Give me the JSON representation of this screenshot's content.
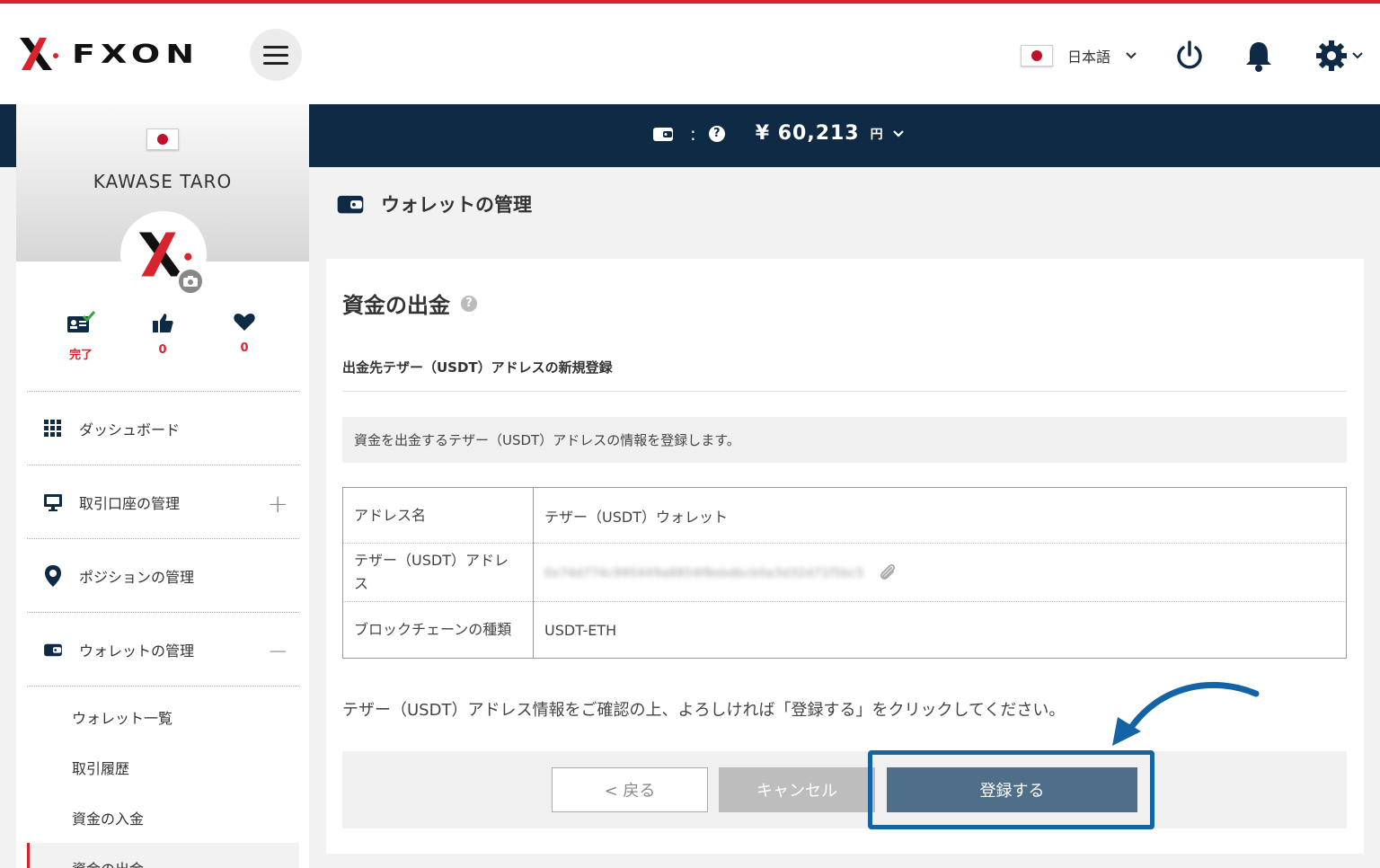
{
  "header": {
    "logo_text": "FXON",
    "language": "日本語"
  },
  "balance": {
    "separator": ":",
    "amount": "¥ 60,213",
    "unit": "円"
  },
  "sidebar": {
    "user_name": "KAWASE TARO",
    "stats": [
      {
        "value": "完了"
      },
      {
        "value": "0"
      },
      {
        "value": "0"
      }
    ],
    "menu": [
      {
        "label": "ダッシュボード"
      },
      {
        "label": "取引口座の管理",
        "toggle": "+"
      },
      {
        "label": "ポジションの管理"
      },
      {
        "label": "ウォレットの管理",
        "toggle": "−"
      }
    ],
    "submenu": [
      {
        "label": "ウォレット一覧"
      },
      {
        "label": "取引履歴"
      },
      {
        "label": "資金の入金"
      },
      {
        "label": "資金の出金"
      }
    ]
  },
  "main": {
    "page_title": "ウォレットの管理",
    "card_title": "資金の出金",
    "help_icon": "?",
    "section_title": "出金先テザー（USDT）アドレスの新規登録",
    "info_text": "資金を出金するテザー（USDT）アドレスの情報を登録します。",
    "rows": [
      {
        "key": "アドレス名",
        "value": "テザー（USDT）ウォレット"
      },
      {
        "key": "テザー（USDT）アドレス",
        "value": "0x74d774c995449a8854f8ebdbcb0a3d32d71f5bc5"
      },
      {
        "key": "ブロックチェーンの種類",
        "value": "USDT-ETH"
      }
    ],
    "confirm_text": "テザー（USDT）アドレス情報をご確認の上、よろしければ「登録する」をクリックしてください。",
    "buttons": {
      "back": "< 戻る",
      "cancel": "キャンセル",
      "register": "登録する"
    }
  },
  "colors": {
    "brand_red": "#d9232e",
    "navy": "#0f2a44",
    "register_button": "#4e6e89",
    "highlight": "#1464a5"
  }
}
